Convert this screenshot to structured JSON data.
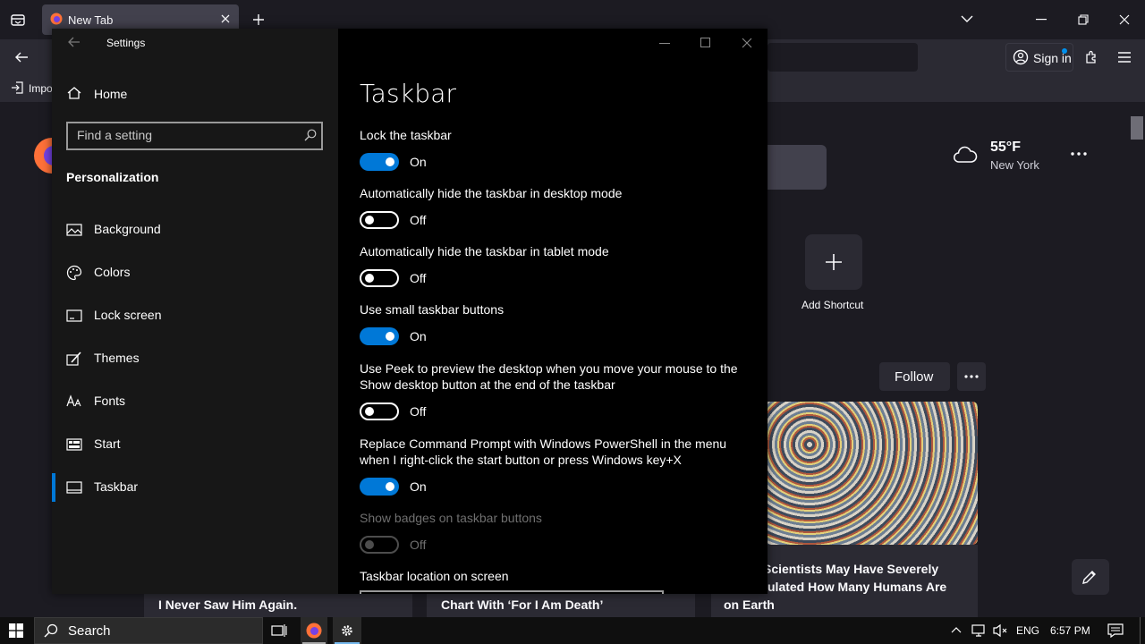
{
  "browser": {
    "tab_title": "New Tab",
    "bookmark_label": "Impo",
    "signin_label": "Sign in",
    "weather": {
      "temp": "55°F",
      "city": "New York"
    },
    "add_shortcut_label": "Add Shortcut",
    "follow_label": "Follow",
    "headlines": [
      "I Never Saw Him Again.",
      "Chart With ‘For I Am Death’",
      "Scientists May Have Severely",
      "ulated How Many Humans Are",
      "on Earth"
    ]
  },
  "settings": {
    "window_title": "Settings",
    "home_label": "Home",
    "search_placeholder": "Find a setting",
    "section_label": "Personalization",
    "nav": [
      {
        "label": "Background",
        "icon": "image-icon"
      },
      {
        "label": "Colors",
        "icon": "palette-icon"
      },
      {
        "label": "Lock screen",
        "icon": "lock-screen-icon"
      },
      {
        "label": "Themes",
        "icon": "brush-icon"
      },
      {
        "label": "Fonts",
        "icon": "font-icon"
      },
      {
        "label": "Start",
        "icon": "start-icon"
      },
      {
        "label": "Taskbar",
        "icon": "taskbar-icon",
        "selected": true
      }
    ],
    "page_title": "Taskbar",
    "options": [
      {
        "label": "Lock the taskbar",
        "state": "On"
      },
      {
        "label": "Automatically hide the taskbar in desktop mode",
        "state": "Off"
      },
      {
        "label": "Automatically hide the taskbar in tablet mode",
        "state": "Off"
      },
      {
        "label": "Use small taskbar buttons",
        "state": "On"
      },
      {
        "label": "Use Peek to preview the desktop when you move your mouse to the Show desktop button at the end of the taskbar",
        "state": "Off"
      },
      {
        "label": "Replace Command Prompt with Windows PowerShell in the menu when I right-click the start button or press Windows key+X",
        "state": "On"
      },
      {
        "label": "Show badges on taskbar buttons",
        "state": "Off",
        "disabled": true
      }
    ],
    "location_label": "Taskbar location on screen"
  },
  "taskbar": {
    "search_label": "Search",
    "language": "ENG",
    "time": "6:57 PM"
  },
  "colors": {
    "accent": "#0078d7",
    "settings_bg": "#000000",
    "sidebar_bg": "#171717"
  }
}
